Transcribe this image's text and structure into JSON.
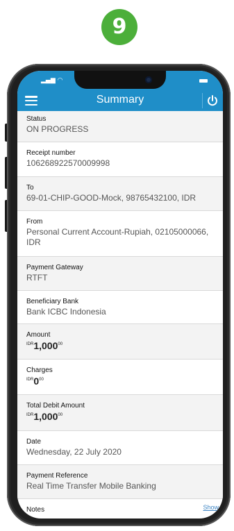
{
  "step_number": "9",
  "colors": {
    "accent": "#1f8ec8",
    "badge": "#4caf3a"
  },
  "header": {
    "title": "Summary",
    "menu_icon": "hamburger-icon",
    "logout_icon": "power-icon"
  },
  "fields": {
    "status": {
      "label": "Status",
      "value": "ON PROGRESS"
    },
    "receipt": {
      "label": "Receipt number",
      "value": "106268922570009998"
    },
    "to": {
      "label": "To",
      "value": "69-01-CHIP-GOOD-Mock, 98765432100, IDR"
    },
    "from": {
      "label": "From",
      "value": "Personal Current Account-Rupiah, 02105000066, IDR"
    },
    "gateway": {
      "label": "Payment Gateway",
      "value": "RTFT"
    },
    "bank": {
      "label": "Beneficiary Bank",
      "value": "Bank ICBC Indonesia"
    },
    "amount": {
      "label": "Amount",
      "currency": "IDR",
      "value": "1,000",
      "decimals": "00"
    },
    "charges": {
      "label": "Charges",
      "currency": "IDR",
      "value": "0",
      "decimals": "00"
    },
    "total": {
      "label": "Total Debit Amount",
      "currency": "IDR",
      "value": "1,000",
      "decimals": "00"
    },
    "date": {
      "label": "Date",
      "value": "Wednesday, 22 July 2020"
    },
    "reference": {
      "label": "Payment Reference",
      "value": "Real Time Transfer Mobile Banking"
    },
    "notes": {
      "label": "Notes",
      "link": "Show"
    }
  }
}
